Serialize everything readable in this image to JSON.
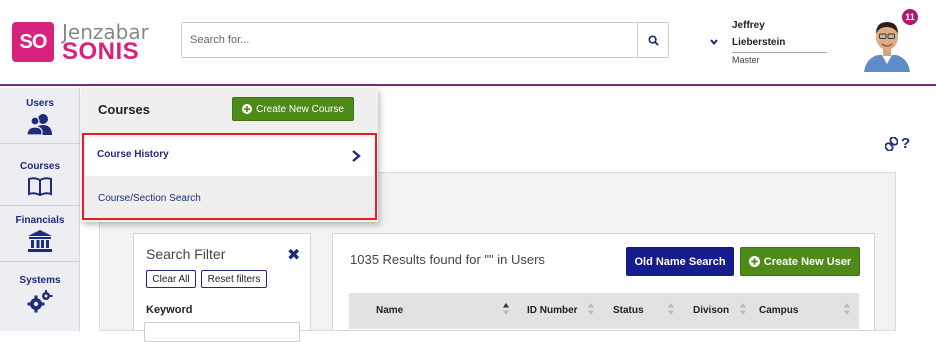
{
  "brand": {
    "logo_abbr": "SO",
    "name_top": "Jenzabar",
    "name_bottom": "SONIS"
  },
  "search": {
    "placeholder": "Search for..."
  },
  "user": {
    "first_name": "Jeffrey",
    "last_name": "Lieberstein",
    "role": "Master",
    "notifications": "11"
  },
  "leftnav": {
    "items": [
      {
        "label": "Users",
        "icon": "users-icon"
      },
      {
        "label": "Courses",
        "icon": "book-icon"
      },
      {
        "label": "Financials",
        "icon": "bank-icon"
      },
      {
        "label": "Systems",
        "icon": "gears-icon"
      }
    ]
  },
  "flyout": {
    "title": "Courses",
    "create_button": "Create New Course",
    "items": [
      {
        "label": "Course History"
      },
      {
        "label": "Course/Section Search"
      }
    ],
    "highlight_color": "#e02027"
  },
  "filter": {
    "title": "Search Filter",
    "clear_all": "Clear All",
    "reset_filters": "Reset filters",
    "keyword_label": "Keyword",
    "keyword_value": ""
  },
  "results": {
    "summary": "1035 Results found for \"\" in Users",
    "old_name_search": "Old Name Search",
    "create_user": "Create New User",
    "columns": [
      "Name",
      "ID Number",
      "Status",
      "Divison",
      "Campus"
    ]
  },
  "colors": {
    "brand_pink": "#d9227e",
    "navy": "#1d2b7a",
    "green": "#4e8a17",
    "header_border": "#7b2a80"
  }
}
